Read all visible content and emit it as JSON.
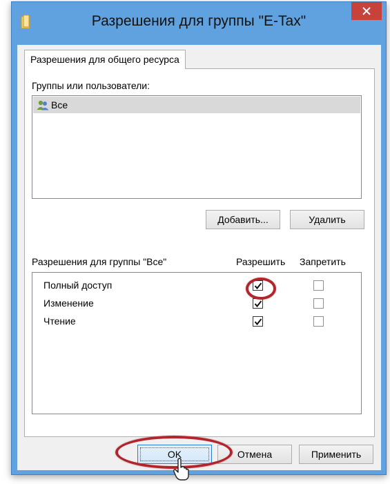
{
  "window": {
    "title": "Разрешения для группы \"E-Tax\"",
    "close_glyph": "✕",
    "titlebar_color": "#5fa2df",
    "close_color": "#c6423a"
  },
  "tab": {
    "label": "Разрешения для общего ресурса"
  },
  "groups": {
    "label": "Группы или пользователи:",
    "items": [
      {
        "label": "Все",
        "icon": "users-icon"
      }
    ],
    "add_label": "Добавить...",
    "remove_label": "Удалить"
  },
  "permissions": {
    "label": "Разрешения для группы \"Все\"",
    "allow_header": "Разрешить",
    "deny_header": "Запретить",
    "rows": [
      {
        "name": "Полный доступ",
        "allow": true,
        "deny": false
      },
      {
        "name": "Изменение",
        "allow": true,
        "deny": false
      },
      {
        "name": "Чтение",
        "allow": true,
        "deny": false
      }
    ]
  },
  "buttons": {
    "ok": "OK",
    "cancel": "Отмена",
    "apply": "Применить"
  },
  "annotation_color": "#b3252c"
}
